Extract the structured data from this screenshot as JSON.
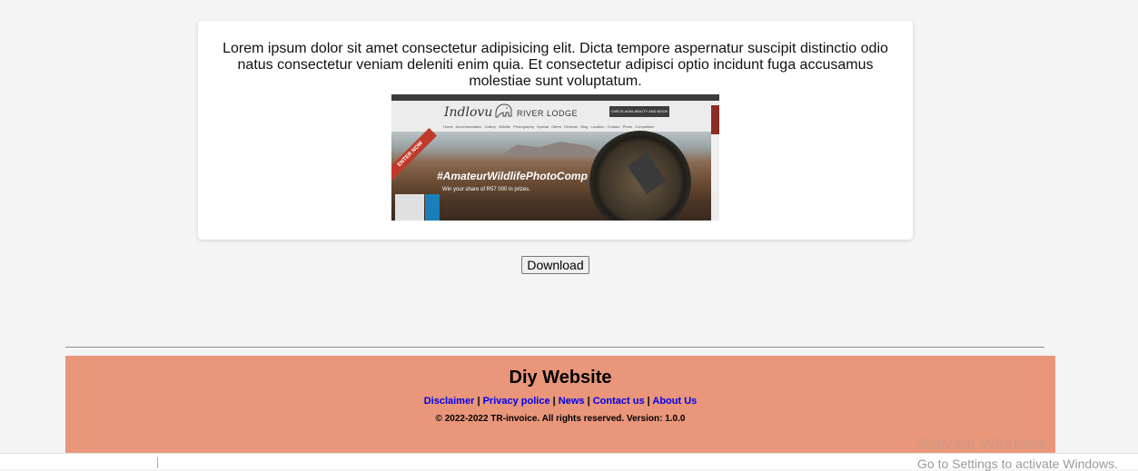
{
  "card": {
    "text": "Lorem ipsum dolor sit amet consectetur adipisicing elit. Dicta tempore aspernatur suscipit distinctio odio natus consectetur veniam deleniti enim quia. Et consectetur adipisci optio incidunt fuga accusamus molestiae sunt voluptatum.",
    "banner": {
      "brand": "Indlovu",
      "lodge": "RIVER LODGE",
      "cta": "CHECK AVAILABILITY AND BOOK",
      "nav": "Home Accommodation Gallery Wildlife Photography Special Offers Reviews Blog Location Contact Photo Competition",
      "ribbon": "ENTER NOW",
      "hashtag": "#AmateurWildlifePhotoComp",
      "prize": "Win your share of R57 000 in prizes."
    }
  },
  "download_label": "Download",
  "footer": {
    "title": "Diy Website",
    "links": [
      "Disclaimer",
      "Privacy police",
      "News",
      "Contact us",
      "About Us"
    ],
    "separator": "|",
    "copyright": "© 2022-2022 TR-invoice. All rights reserved. Version: 1.0.0",
    "bg_color": "#e9967a",
    "link_color": "#0000ee"
  },
  "watermark": {
    "title": "Activate Windows",
    "subtitle": "Go to Settings to activate Windows."
  }
}
